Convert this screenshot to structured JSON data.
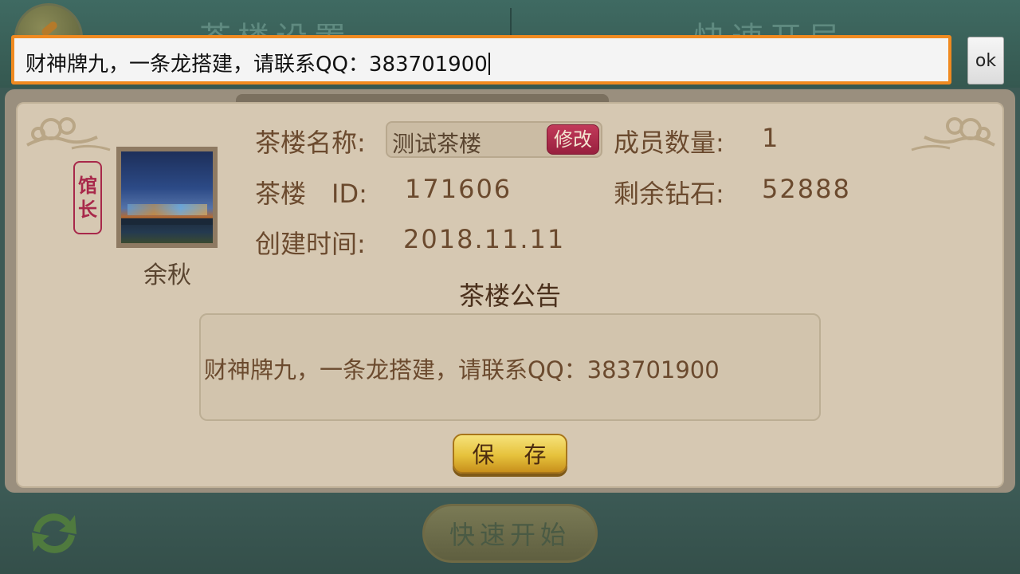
{
  "background": {
    "tab_left": "茶楼设置",
    "tab_right": "快速开局",
    "quick_start_label": "快速开始"
  },
  "dialog": {
    "role_badge": "馆长",
    "owner_name": "余秋",
    "fields": {
      "name_label": "茶楼名称:",
      "name_value": "测试茶楼",
      "edit_label": "修改",
      "members_label": "成员数量:",
      "members_value": "1",
      "id_label": "茶楼　ID:",
      "id_value": "171606",
      "diamonds_label": "剩余钻石:",
      "diamonds_value": "52888",
      "created_label": "创建时间:",
      "created_value": "2018.11.11"
    },
    "notice": {
      "title": "茶楼公告",
      "text": "财神牌九，一条龙搭建，请联系QQ：383701900"
    },
    "save_label": "保 存"
  },
  "ime": {
    "input_value": "财神牌九，一条龙搭建，请联系QQ：383701900",
    "ok_label": "ok",
    "accent_color": "#f08a20"
  },
  "icons": [
    "back-icon",
    "cloud-ornament-icon",
    "refresh-icon"
  ]
}
